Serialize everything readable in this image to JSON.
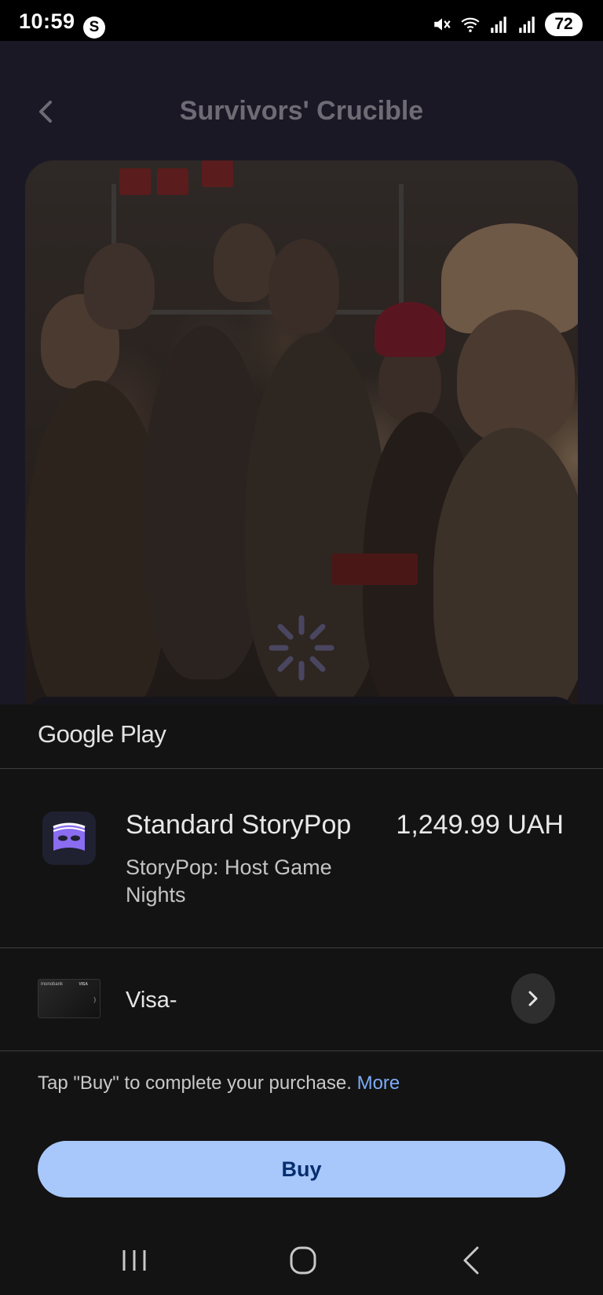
{
  "status_bar": {
    "time": "10:59",
    "app_icon_letter": "S",
    "battery": "72",
    "icons": [
      "mute-icon",
      "wifi-icon",
      "signal-icon",
      "signal-icon"
    ]
  },
  "app": {
    "title": "Survivors' Crucible"
  },
  "sheet": {
    "store_logo": "Google Play",
    "product": {
      "title": "Standard StoryPop",
      "price": "1,249.99 UAH",
      "app_name": "StoryPop: Host Game Nights"
    },
    "payment": {
      "method_label": "Visa-"
    },
    "info": {
      "text": "Tap \"Buy\" to complete your purchase.",
      "more_link": "More"
    },
    "buy_label": "Buy"
  },
  "colors": {
    "buy_button_bg": "#a8c7fa",
    "buy_button_text": "#062e6f",
    "link": "#7cacf8",
    "sheet_bg": "#131313"
  }
}
